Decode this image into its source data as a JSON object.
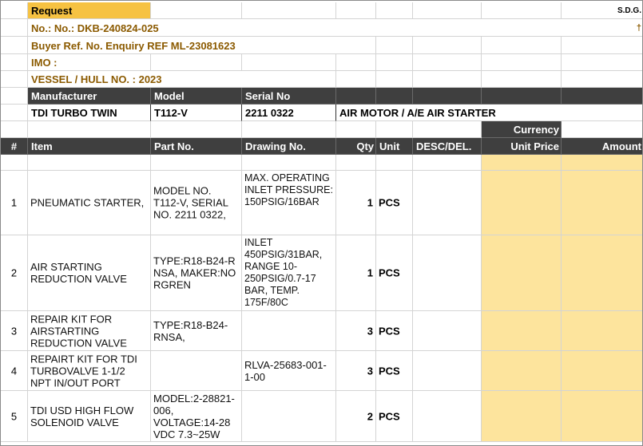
{
  "header": {
    "request_label": "Request",
    "sdg": "S.D.G.",
    "cross": "†",
    "no_line": "No.: No.: DKB-240824-025",
    "buyer_ref": "Buyer Ref. No. Enquiry REF ML-23081623",
    "imo": "IMO :",
    "vessel": "VESSEL / HULL NO. : 2023"
  },
  "equipment": {
    "headers": {
      "manufacturer": "Manufacturer",
      "model": "Model",
      "serial": "Serial No"
    },
    "manufacturer": "TDI TURBO TWIN",
    "model": "T112-V",
    "serial": "2211 0322",
    "description": "AIR MOTOR / A/E AIR STARTER"
  },
  "currency_label": "Currency",
  "columns": {
    "num": "#",
    "item": "Item",
    "part": "Part No.",
    "drawing": "Drawing No.",
    "qty": "Qty",
    "unit": "Unit",
    "desc": "DESC/DEL.",
    "unit_price": "Unit Price",
    "amount": "Amount"
  },
  "rows": [
    {
      "num": "1",
      "item": "PNEUMATIC STARTER,",
      "part": "MODEL NO. T112-V, SERIAL NO. 2211 0322,",
      "drawing": "MAX. OPERATING INLET PRESSURE: 150PSIG/16BAR",
      "qty": "1",
      "unit": "PCS"
    },
    {
      "num": "2",
      "item": "AIR STARTING REDUCTION VALVE",
      "part": "TYPE:R18-B24-RNSA, MAKER:NORGREN",
      "drawing": "INLET 450PSIG/31BAR, RANGE 10-250PSIG/0.7-17 BAR, TEMP. 175F/80C",
      "qty": "1",
      "unit": "PCS"
    },
    {
      "num": "3",
      "item": "REPAIR KIT FOR AIRSTARTING REDUCTION VALVE",
      "part": "TYPE:R18-B24-RNSA,",
      "drawing": "",
      "qty": "3",
      "unit": "PCS"
    },
    {
      "num": "4",
      "item": "REPAIRT KIT FOR TDI TURBOVALVE 1-1/2 NPT IN/OUT PORT",
      "part": "",
      "drawing": "RLVA-25683-001-1-00",
      "qty": "3",
      "unit": "PCS"
    },
    {
      "num": "5",
      "item": "TDI USD HIGH FLOW SOLENOID VALVE",
      "part": "MODEL:2-28821-006, VOLTAGE:14-28 VDC 7.3~25W",
      "drawing": "",
      "qty": "2",
      "unit": "PCS"
    }
  ]
}
